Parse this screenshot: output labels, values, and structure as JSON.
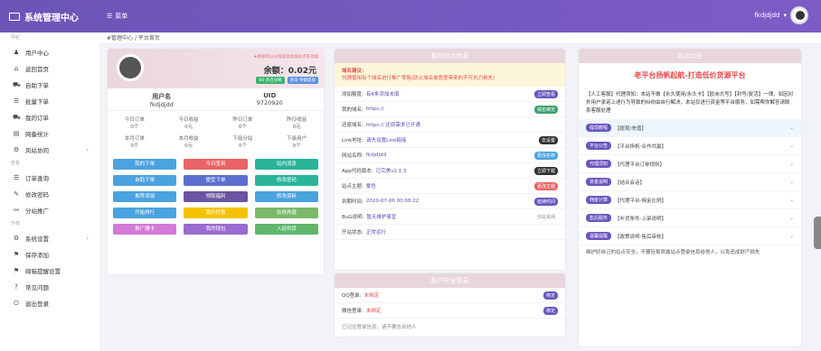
{
  "header": {
    "brand": "系统管理中心",
    "menu_label": "菜单",
    "username": "fkdjdjdd"
  },
  "breadcrumb": {
    "home": "#管理中心",
    "sep": "/",
    "current": "平台首页"
  },
  "sidebar": {
    "sections": [
      {
        "title": "导航",
        "items": [
          {
            "icon": "user-icon",
            "label": "用户中心"
          },
          {
            "icon": "home-icon",
            "label": "返回首页"
          },
          {
            "icon": "cart-icon",
            "label": "自助下单"
          },
          {
            "icon": "list-icon",
            "label": "批量下单"
          },
          {
            "icon": "cart-icon",
            "label": "我的订单"
          },
          {
            "icon": "chart-icon",
            "label": "网备统计"
          },
          {
            "icon": "gear-icon",
            "label": "风站协同",
            "arrow": "›"
          }
        ]
      },
      {
        "title": "查看",
        "items": [
          {
            "icon": "list-icon",
            "label": "订单查询"
          },
          {
            "icon": "edit-icon",
            "label": "修改密码"
          },
          {
            "icon": "link-icon",
            "label": "分站推广"
          }
        ]
      },
      {
        "title": "升级",
        "items": [
          {
            "icon": "gear-icon",
            "label": "系统设置",
            "arrow": "›"
          },
          {
            "icon": "flag-icon",
            "label": "保存添加"
          },
          {
            "icon": "flag-icon",
            "label": "邮箱提醒设置"
          },
          {
            "icon": "help-icon",
            "label": "常见问题"
          },
          {
            "icon": "power-icon",
            "label": "退出登录"
          }
        ]
      }
    ]
  },
  "profile": {
    "notice": "★余额可以分批提现添加站点等功能",
    "balance": "余额：0.02元",
    "btn1": "00 开启分销",
    "btn2": "查询 余额提现",
    "name_label": "用户名",
    "name": "fkdjdjdd",
    "uid_label": "UID",
    "uid": "9720920",
    "stats": [
      {
        "l": "今日订单",
        "v": "0个"
      },
      {
        "l": "今日收益",
        "v": "0元"
      },
      {
        "l": "昨日订单",
        "v": "0个"
      },
      {
        "l": "昨日收益",
        "v": "0元"
      },
      {
        "l": "本月订单",
        "v": "0个"
      },
      {
        "l": "本月收益",
        "v": "0元"
      },
      {
        "l": "下级分站",
        "v": "0个"
      },
      {
        "l": "下级用户",
        "v": "0个"
      }
    ],
    "buttons": [
      {
        "t": "我的下单",
        "c": "#4aa3df"
      },
      {
        "t": "今日签到",
        "c": "#e96466"
      },
      {
        "t": "站内消息",
        "c": "#28b59a"
      },
      {
        "t": "自助下单",
        "c": "#4aa3df"
      },
      {
        "t": "便宜下单",
        "c": "#5b6fd1"
      },
      {
        "t": "修改密码",
        "c": "#28b59a"
      },
      {
        "t": "推荐添加",
        "c": "#4aa3df"
      },
      {
        "t": "领取福利",
        "c": "#6a55a0"
      },
      {
        "t": "修改资料",
        "c": "#4aa3df"
      },
      {
        "t": "开始排行",
        "c": "#4aa3df"
      },
      {
        "t": "我的优惠",
        "c": "#f5c200"
      },
      {
        "t": "在线充值",
        "c": "#7bb86a"
      },
      {
        "t": "推广赚卡",
        "c": "#d37bd6"
      },
      {
        "t": "我的钱包",
        "c": "#9a6bd1"
      },
      {
        "t": "入驻供货",
        "c": "#5fb76b"
      }
    ]
  },
  "site": {
    "title": "我的站点信息",
    "warn_title": "域名建议:",
    "warn": "代理使用有个域名进行推广零售(防止域名被恶意带来的不可抗力损失)",
    "rows": [
      {
        "l": "添加额度:",
        "v": "有4条添加未填",
        "b": "立即查看",
        "c": "#6a55c0"
      },
      {
        "l": "我的域名:",
        "v": "https://",
        "b": "域名绑定",
        "c": "#3ca06e"
      },
      {
        "l": "还原域名:",
        "v": "https:// 还原需求已开通",
        "b": "",
        "c": ""
      },
      {
        "l": "Link地址:",
        "v": "请先设置Link链接",
        "b": "去设置",
        "c": "#333"
      },
      {
        "l": "网站名称:",
        "v": "fkdjdjdd",
        "b": "更改名称",
        "c": "#4aa3df"
      },
      {
        "l": "App代码版本:",
        "v": "已完美v2.1.3",
        "b": "立即下载",
        "c": "#333"
      },
      {
        "l": "站点主题:",
        "v": "紫色",
        "b": "更改主题",
        "c": "#e96466"
      },
      {
        "l": "到期时间:",
        "v": "2020-07-06 00:08:22",
        "b": "延续时间",
        "c": "#6a55c0"
      },
      {
        "l": "BuG说明:",
        "v": "暂无维护事宜",
        "b": "分站关闭",
        "c": ""
      },
      {
        "l": "开站状态:",
        "v": "正常运行",
        "b": "",
        "c": ""
      }
    ]
  },
  "account": {
    "title": "账户安全登录",
    "rows": [
      {
        "l": "QQ登录:",
        "v": "未绑定",
        "b": "绑定"
      },
      {
        "l": "微信登录:",
        "v": "未绑定",
        "b": "绑定"
      }
    ],
    "tip": "已记住登录信息，请不要告诉他人"
  },
  "notice": {
    "title": "站点公告",
    "slogan": "老平台扬帆起航-打造低价货源平台",
    "desc": "【人工客服】代理须知：本站不做【永久使用/永久卡】【欧洲大号】【封号/复活】一律，如因对外用户承诺上述行为导致的纠纷由自行解决，本站仅进行资金等平台服务，如需帮你解答请联系客服处理",
    "items": [
      {
        "t": "提现教程",
        "v": "【提现/充值】",
        "hl": true
      },
      {
        "t": "平台公告",
        "v": "【平台扬帆-合作共赢】"
      },
      {
        "t": "代理须知",
        "v": "【代理平台订单规则】"
      },
      {
        "t": "资金说明",
        "v": "【结合会话】"
      },
      {
        "t": "佣金计算",
        "v": "【代理平台-佣金比例】"
      },
      {
        "t": "售后服务",
        "v": "【补货条件-上架说明】"
      },
      {
        "t": "温馨提醒",
        "v": "【政策说明-售后审核】"
      }
    ],
    "footer": "维护好自己的站点安全，不要轻易泄露站点登录信息给他人，以免造成财产损失"
  }
}
